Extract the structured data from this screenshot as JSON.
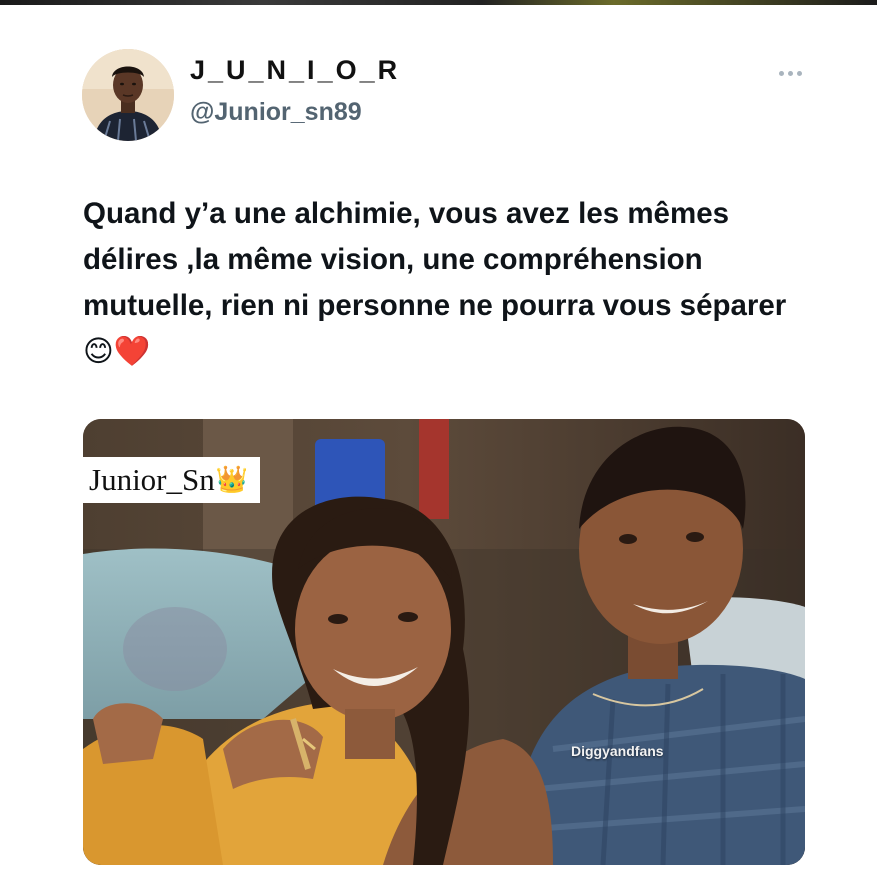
{
  "tweet": {
    "display_name": "J_U_N_I_O_R",
    "handle": "@Junior_sn89",
    "text": "Quand y’a une alchimie, vous avez les mêmes délires ,la même vision, une compréhension mutuelle, rien ni personne ne pourra vous séparer",
    "emojis": "😊❤️",
    "more_icon": "more-horizontal-icon"
  },
  "media": {
    "watermark_text": "Junior_Sn",
    "watermark_emoji": "👑",
    "photo_credit": "Diggyandfans"
  },
  "colors": {
    "text_primary": "#0f1419",
    "text_secondary": "#536471",
    "background": "#ffffff"
  }
}
